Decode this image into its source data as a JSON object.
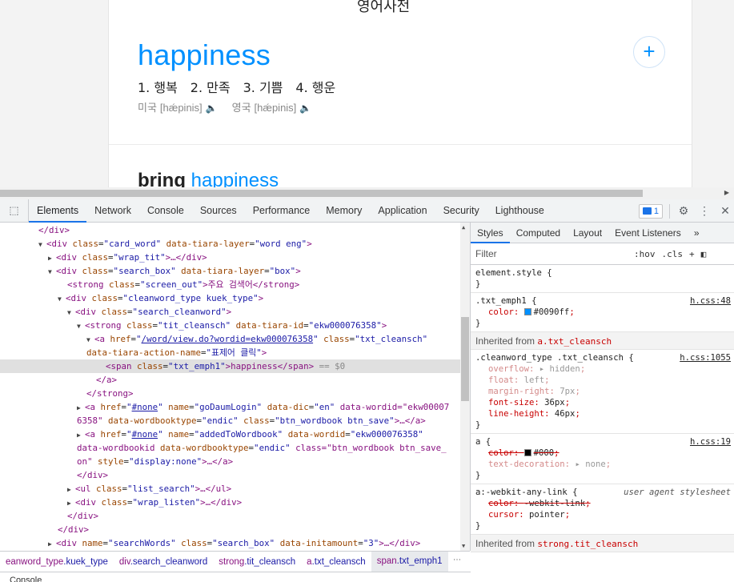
{
  "page": {
    "header_title": "영어사전",
    "word": "happiness",
    "add_button": "+",
    "meanings": [
      "1. 행복",
      "2. 만족",
      "3. 기쁨",
      "4. 행운"
    ],
    "pronunciations": [
      {
        "region": "미국",
        "ipa": "[hǽpinis]"
      },
      {
        "region": "영국",
        "ipa": "[hǽpinis]"
      }
    ],
    "related_prefix": "bring",
    "related_word": "happiness"
  },
  "devtools": {
    "tabs": [
      "Elements",
      "Network",
      "Console",
      "Sources",
      "Performance",
      "Memory",
      "Application",
      "Security",
      "Lighthouse"
    ],
    "active_tab": "Elements",
    "issues_count": "1",
    "tree": [
      {
        "t": "    </div>",
        "i": 4
      },
      {
        "t": "▼<div class=\"card_word\" data-tiara-layer=\"word eng\">",
        "i": 4
      },
      {
        "t": "▶<div class=\"wrap_tit\">…</div>",
        "i": 5
      },
      {
        "t": "▼<div class=\"search_box\" data-tiara-layer=\"box\">",
        "i": 5
      },
      {
        "t": "<strong class=\"screen_out\">주요 검색어</strong>",
        "i": 7
      },
      {
        "t": "▼<div class=\"cleanword_type kuek_type\">",
        "i": 6
      },
      {
        "t": "▼<div class=\"search_cleanword\">",
        "i": 7
      },
      {
        "t": "▼<strong class=\"tit_cleansch\" data-tiara-id=\"ekw000076358\">",
        "i": 8
      },
      {
        "t": "▼<a href=\"/word/view.do?wordid=ekw000076358\" class=\"txt_cleansch\"",
        "i": 9
      },
      {
        "t": "data-tiara-action-name=\"표제어 클릭\">",
        "i": 9
      },
      {
        "t": "<span class=\"txt_emph1\">happiness</span> == $0",
        "i": 11
      },
      {
        "t": "</a>",
        "i": 10
      },
      {
        "t": "</strong>",
        "i": 9
      },
      {
        "t": "▶<a href=\"#none\" name=\"goDaumLogin\" data-dic=\"en\" data-wordid=\"ekw00007",
        "i": 8
      },
      {
        "t": "6358\" data-wordbooktype=\"endic\" class=\"btn_wordbook btn_save\">…</a>",
        "i": 8
      },
      {
        "t": "▶<a href=\"#none\" name=\"addedToWordbook\" data-wordid=\"ekw000076358\"",
        "i": 8
      },
      {
        "t": "data-wordbookid data-wordbooktype=\"endic\" class=\"btn_wordbook btn_save_",
        "i": 8
      },
      {
        "t": "on\" style=\"display:none\">…</a>",
        "i": 8
      },
      {
        "t": "</div>",
        "i": 8
      },
      {
        "t": "▶<ul class=\"list_search\">…</ul>",
        "i": 7
      },
      {
        "t": "▶<div class=\"wrap_listen\">…</div>",
        "i": 7
      },
      {
        "t": "</div>",
        "i": 7
      },
      {
        "t": "</div>",
        "i": 6
      },
      {
        "t": "▶<div name=\"searchWords\" class=\"search_box\" data-initamount=\"3\">…</div>",
        "i": 5
      }
    ],
    "breadcrumbs": [
      "eanword_type.kuek_type",
      "div.search_cleanword",
      "strong.tit_cleansch",
      "a.txt_cleansch",
      "span.txt_emph1"
    ],
    "console_label": "Console",
    "styles": {
      "tabs": [
        "Styles",
        "Computed",
        "Layout",
        "Event Listeners",
        "»"
      ],
      "filter_placeholder": "Filter",
      "hov": ":hov",
      "cls": ".cls",
      "element_style": "element.style {",
      "rules": [
        {
          "selector": ".txt_emph1 {",
          "source": "h.css:48",
          "props": [
            {
              "name": "color",
              "value": "#0090ff",
              "swatch": "#0090ff"
            }
          ]
        },
        {
          "inherited": "Inherited from",
          "from": "a.txt_cleansch"
        },
        {
          "selector": ".cleanword_type .txt_cleansch {",
          "source": "h.css:1055",
          "props": [
            {
              "name": "overflow",
              "value": "▸ hidden",
              "faded": true
            },
            {
              "name": "float",
              "value": "left",
              "faded": true
            },
            {
              "name": "margin-right",
              "value": "7px",
              "faded": true
            },
            {
              "name": "font-size",
              "value": "36px"
            },
            {
              "name": "line-height",
              "value": "46px"
            }
          ]
        },
        {
          "selector": "a {",
          "source": "h.css:19",
          "props": [
            {
              "name": "color",
              "value": "#000",
              "swatch": "#000000",
              "strike": true
            },
            {
              "name": "text-decoration",
              "value": "▸ none",
              "faded": true
            }
          ]
        },
        {
          "selector": "a:-webkit-any-link {",
          "source": "user agent stylesheet",
          "ua": true,
          "props": [
            {
              "name": "color",
              "value": "-webkit-link",
              "strike": true
            },
            {
              "name": "cursor",
              "value": "pointer"
            }
          ]
        },
        {
          "inherited": "Inherited from",
          "from": "strong.tit_cleansch"
        }
      ]
    }
  },
  "colors": {
    "accent": "#0090ff",
    "devtools_blue": "#1a73e8",
    "tag": "#881280"
  }
}
